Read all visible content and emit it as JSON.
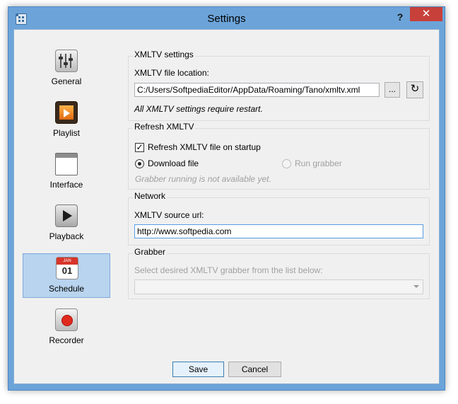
{
  "window": {
    "title": "Settings",
    "help_label": "?",
    "close_label": "✕"
  },
  "sidebar": {
    "items": [
      {
        "label": "General",
        "icon": "general-icon",
        "selected": false
      },
      {
        "label": "Playlist",
        "icon": "playlist-icon",
        "selected": false
      },
      {
        "label": "Interface",
        "icon": "interface-icon",
        "selected": false
      },
      {
        "label": "Playback",
        "icon": "playback-icon",
        "selected": false
      },
      {
        "label": "Schedule",
        "icon": "schedule-icon",
        "selected": true,
        "icon_top": "JAN",
        "icon_day": "01"
      },
      {
        "label": "Recorder",
        "icon": "recorder-icon",
        "selected": false
      }
    ]
  },
  "xmltv_settings": {
    "title": "XMLTV settings",
    "file_location_label": "XMLTV file location:",
    "file_location_value": "C:/Users/SoftpediaEditor/AppData/Roaming/Tano/xmltv.xml",
    "browse_label": "...",
    "reset_icon": "reset-icon",
    "note": "All XMLTV settings require restart."
  },
  "refresh_xmltv": {
    "title": "Refresh XMLTV",
    "refresh_on_startup_label": "Refresh XMLTV file on startup",
    "refresh_on_startup_checked": true,
    "download_label": "Download file",
    "download_selected": true,
    "grabber_label": "Run grabber",
    "grabber_selected": false,
    "grabber_note": "Grabber running is not available yet."
  },
  "network": {
    "title": "Network",
    "source_url_label": "XMLTV source url:",
    "source_url_value": "http://www.softpedia.com"
  },
  "grabber": {
    "title": "Grabber",
    "select_label": "Select desired XMLTV grabber from the list below:",
    "selected_value": ""
  },
  "footer": {
    "save_label": "Save",
    "cancel_label": "Cancel"
  },
  "colors": {
    "title_bar": "#6ca4d9",
    "close_button": "#c7413a",
    "selected_item": "#b8d4ef",
    "client_bg": "#f0f0f0"
  }
}
